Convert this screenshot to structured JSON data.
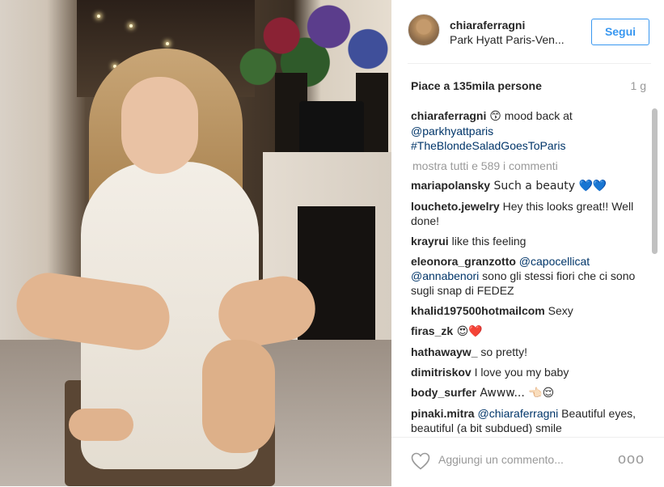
{
  "post": {
    "username": "chiaraferragni",
    "location": "Park Hyatt Paris-Ven...",
    "follow_label": "Segui",
    "likes_text": "Piace a 135mila persone",
    "time": "1 g"
  },
  "caption": {
    "user": "chiaraferragni",
    "emoji": "😙",
    "text": " mood back at ",
    "mention": "@parkhyattparis",
    "hashtag": "#TheBlondeSaladGoesToParis"
  },
  "show_all": "mostra tutti e 589 i commenti",
  "comments": [
    {
      "user": "mariapolansky",
      "text": " Such a beauty 💙💙"
    },
    {
      "user": "loucheto.jewelry",
      "text": " Hey this looks great!! Well done!"
    },
    {
      "user": "krayrui",
      "text": " like this feeling"
    },
    {
      "user": "eleonora_granzotto",
      "mention1": "@capocellicat",
      "mention2": "@annabenori",
      "text": " sono gli stessi fiori che ci sono sugli snap di FEDEZ"
    },
    {
      "user": "khalid197500hotmailcom",
      "text": " Sexy"
    },
    {
      "user": "firas_zk",
      "text": " 😍❤️"
    },
    {
      "user": "hathawayw_",
      "text": " so pretty!"
    },
    {
      "user": "dimitriskov",
      "text": " I love you my baby"
    },
    {
      "user": "body_surfer",
      "text": " Awww... 👈🏻😌"
    },
    {
      "user": "pinaki.mitra",
      "mention": "@chiaraferragni",
      "text": " Beautiful eyes, beautiful (a bit subdued) smile"
    }
  ],
  "footer": {
    "add_comment_placeholder": "Aggiungi un commento...",
    "more": "ooo"
  },
  "icons": {
    "like": "heart-outline-icon",
    "options": "more-options-icon"
  },
  "colors": {
    "accent": "#3897f0",
    "link": "#003569",
    "muted": "#999999"
  }
}
